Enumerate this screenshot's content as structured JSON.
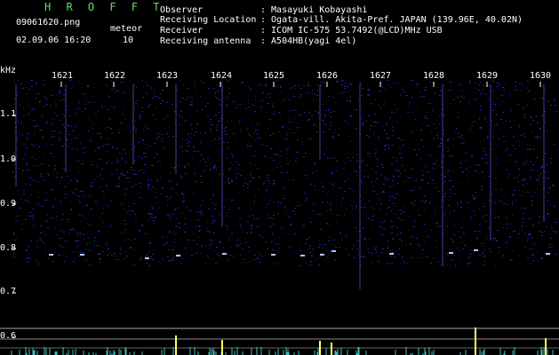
{
  "header": {
    "app_title": "H R O F F T",
    "filename": "09061620.png",
    "datetime": "02.09.06 16:20",
    "mode_label": "meteor",
    "count": "10",
    "observer_label": "Observer",
    "observer_value": ": Masayuki Kobayashi",
    "location_label": "Receiving Location",
    "location_value": ": Ogata-vill. Akita-Pref. JAPAN (139.96E, 40.02N)",
    "receiver_label": "Receiver",
    "receiver_value": ": ICOM IC-575 53.7492(@LCD)MHz USB",
    "antenna_label": "Receiving antenna",
    "antenna_value": ": A504HB(yagi 4el)"
  },
  "time_axis": {
    "labels": [
      "1621",
      "1622",
      "1623",
      "1624",
      "1625",
      "1626",
      "1627",
      "1628",
      "1629",
      "1630"
    ]
  },
  "freq_axis": {
    "unit": "kHz",
    "labels": [
      "1.1",
      "1.0",
      "0.9",
      "0.8",
      "0.7",
      "0.6"
    ]
  },
  "colors": {
    "title": "#5ee05e",
    "background": "#000000",
    "noise": "#2a2aa8",
    "signal": "#aaccff",
    "meter": "#ffff66"
  }
}
